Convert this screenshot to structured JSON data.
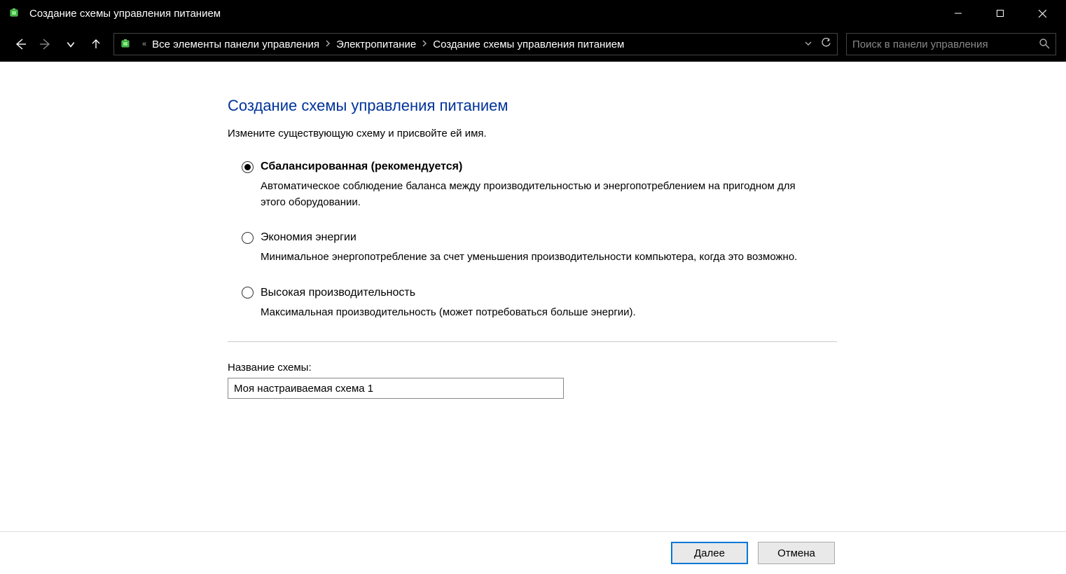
{
  "window": {
    "title": "Создание схемы управления питанием"
  },
  "breadcrumb": {
    "chevrons_back": "«",
    "items": [
      "Все элементы панели управления",
      "Электропитание",
      "Создание схемы управления питанием"
    ]
  },
  "search": {
    "placeholder": "Поиск в панели управления"
  },
  "page": {
    "heading": "Создание схемы управления питанием",
    "subheading": "Измените существующую схему и присвойте ей имя."
  },
  "options": [
    {
      "label": "Сбалансированная (рекомендуется)",
      "desc": "Автоматическое соблюдение баланса между производительностью и энергопотреблением на пригодном для этого оборудовании.",
      "selected": true
    },
    {
      "label": "Экономия энергии",
      "desc": "Минимальное энергопотребление за счет уменьшения производительности компьютера, когда это возможно.",
      "selected": false
    },
    {
      "label": "Высокая производительность",
      "desc": "Максимальная производительность (может потребоваться больше энергии).",
      "selected": false
    }
  ],
  "plan_name": {
    "label": "Название схемы:",
    "value": "Моя настраиваемая схема 1"
  },
  "buttons": {
    "next": "Далее",
    "cancel": "Отмена"
  }
}
